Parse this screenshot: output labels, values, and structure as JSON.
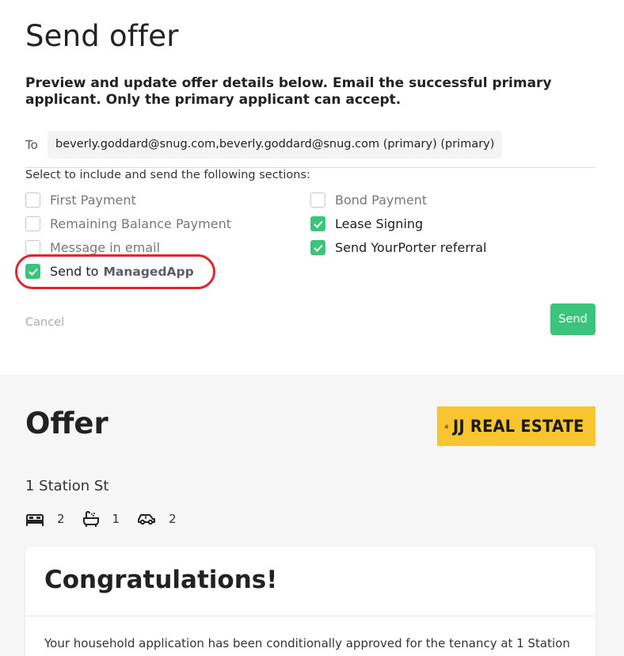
{
  "header": {
    "title": "Send offer",
    "description": "Preview and update offer details below. Email the successful primary applicant. Only the primary applicant can accept."
  },
  "recipient": {
    "label": "To",
    "value": "beverly.goddard@snug.com,beverly.goddard@snug.com (primary) (primary)"
  },
  "sections": {
    "label": "Select to include and send the following sections:",
    "options": [
      {
        "label": "First Payment",
        "checked": false
      },
      {
        "label": "Bond Payment",
        "checked": false
      },
      {
        "label": "Remaining Balance Payment",
        "checked": false
      },
      {
        "label": "Lease Signing",
        "checked": true
      },
      {
        "label": "Message in email",
        "checked": false
      },
      {
        "label": "Send YourPorter referral",
        "checked": true
      },
      {
        "label": "Send to",
        "brand": "ManagedApp",
        "checked": true
      }
    ]
  },
  "actions": {
    "cancel_label": "Cancel",
    "send_label": "Send"
  },
  "offer": {
    "title": "Offer",
    "agency_logo_text": "JJ REAL ESTATE",
    "address": "1 Station St",
    "features": {
      "bedrooms": "2",
      "bathrooms": "1",
      "parking": "2"
    },
    "card": {
      "heading": "Congratulations!",
      "body": "Your household application has been conditionally approved for the tenancy at 1 Station"
    }
  },
  "colors": {
    "accent_green": "#3cc47c",
    "highlight_red": "#e0252c",
    "logo_yellow": "#f8c530"
  }
}
